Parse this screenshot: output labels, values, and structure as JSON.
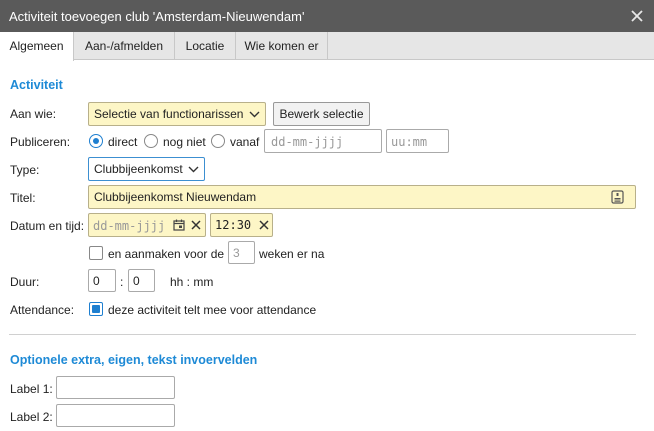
{
  "window": {
    "title": "Activiteit toevoegen club 'Amsterdam-Nieuwendam'"
  },
  "tabs": [
    {
      "label": "Algemeen",
      "active": true
    },
    {
      "label": "Aan-/afmelden",
      "active": false
    },
    {
      "label": "Locatie",
      "active": false
    },
    {
      "label": "Wie komen er",
      "active": false
    }
  ],
  "activiteit": {
    "heading": "Activiteit",
    "aan_wie": {
      "label": "Aan wie:",
      "selected": "Selectie van functionarissen",
      "button": "Bewerk selectie"
    },
    "publiceren": {
      "label": "Publiceren:",
      "options": [
        "direct",
        "nog niet",
        "vanaf"
      ],
      "selected": "direct",
      "date_placeholder": "dd-mm-jjjj",
      "time_placeholder": "uu:mm"
    },
    "type": {
      "label": "Type:",
      "selected": "Clubbijeenkomst"
    },
    "titel": {
      "label": "Titel:",
      "value": "Clubbijeenkomst Nieuwendam"
    },
    "datum": {
      "label": "Datum en tijd:",
      "date_placeholder": "dd-mm-jjjj",
      "time_hour": "12",
      "time_minute": "30"
    },
    "herhaal": {
      "checked": false,
      "prefix": "en aanmaken voor de",
      "weeks_value": "3",
      "suffix": "weken er na"
    },
    "duur": {
      "label": "Duur:",
      "hours": "0",
      "minutes": "0",
      "separator": ":",
      "unit": "hh : mm"
    },
    "attendance": {
      "label": "Attendance:",
      "checked": true,
      "text": "deze activiteit telt mee voor attendance"
    }
  },
  "extra": {
    "heading": "Optionele extra, eigen, tekst invoervelden",
    "fields": [
      {
        "label": "Label 1:",
        "value": ""
      },
      {
        "label": "Label 2:",
        "value": ""
      }
    ]
  },
  "colors": {
    "accent": "#1e8ad6",
    "titlebar": "#5a5a5a",
    "highlight_field": "#fdf6c6"
  },
  "icons": [
    "close-icon",
    "chevron-down-icon",
    "calendar-icon",
    "clear-icon",
    "text-options-icon"
  ]
}
